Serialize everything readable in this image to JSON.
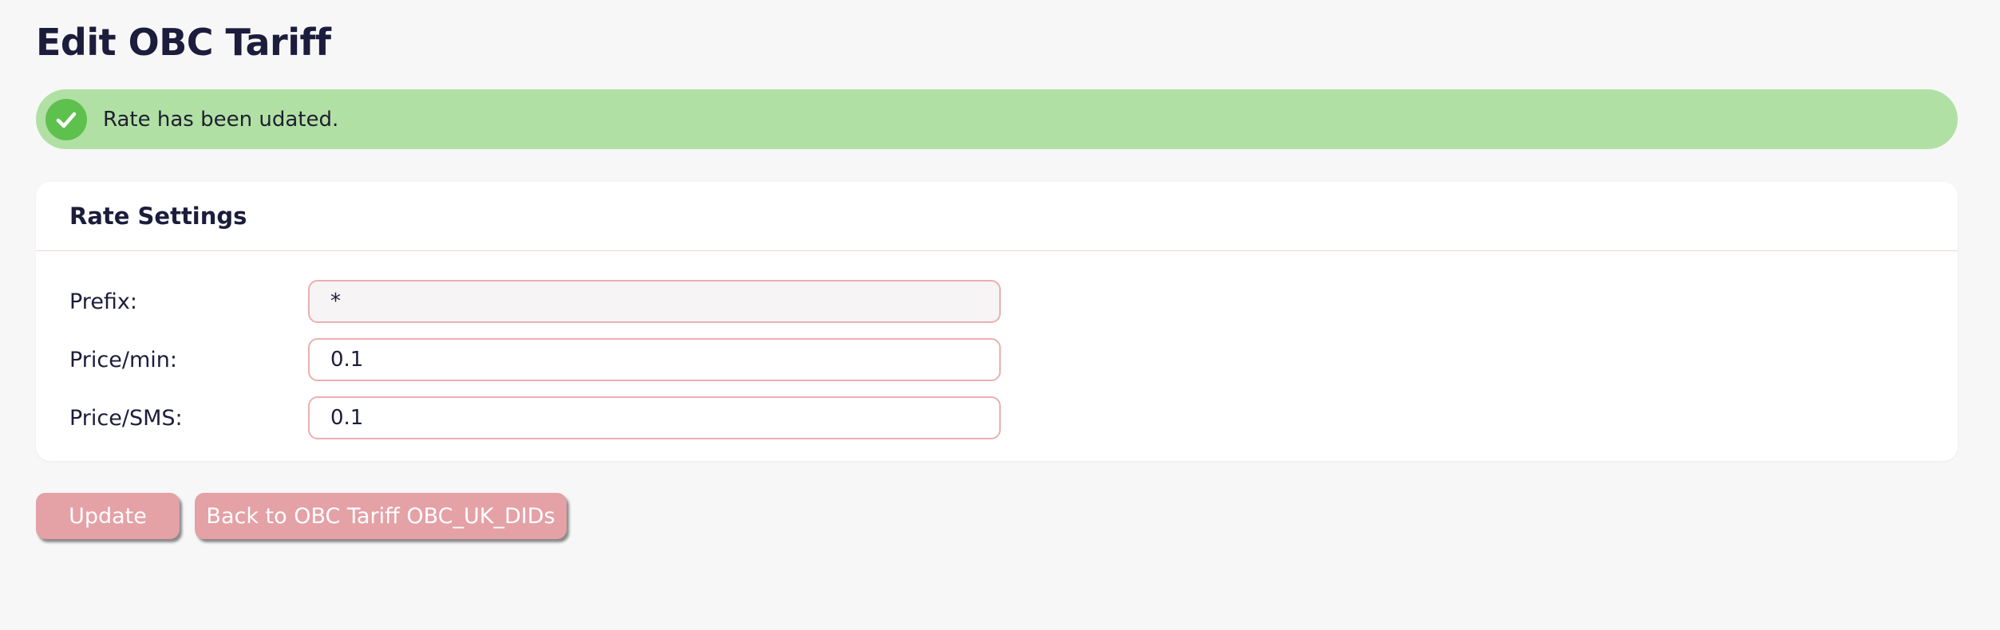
{
  "page": {
    "title": "Edit OBC Tariff"
  },
  "alert": {
    "message": "Rate has been udated.",
    "icon": "check-circle-icon",
    "color": "#b1e0a4",
    "icon_color": "#5ec14d"
  },
  "panel": {
    "title": "Rate Settings",
    "fields": [
      {
        "label": "Prefix:",
        "value": "*",
        "readonly": true
      },
      {
        "label": "Price/min:",
        "value": "0.1",
        "readonly": false
      },
      {
        "label": "Price/SMS:",
        "value": "0.1",
        "readonly": false
      }
    ]
  },
  "buttons": {
    "update_label": "Update",
    "back_label": "Back to OBC Tariff OBC_UK_DIDs",
    "color": "#e4a1a6"
  }
}
